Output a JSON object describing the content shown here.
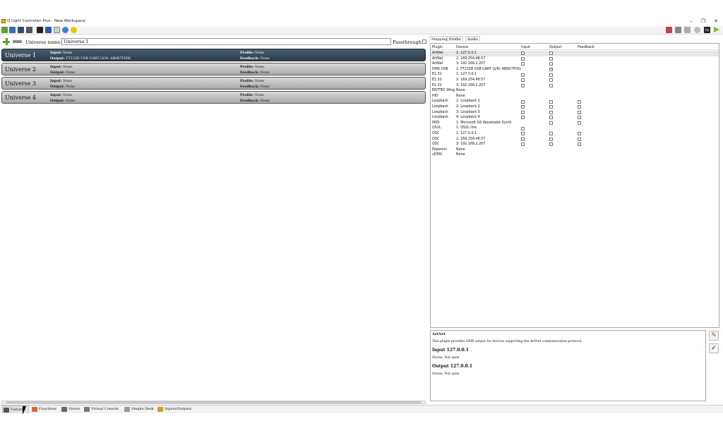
{
  "window": {
    "title": "Q Light Controller Plus - New Workspace",
    "minimize": "–",
    "restore": "❐",
    "close": "✕"
  },
  "universe_editor": {
    "name_label": "Universe name:",
    "name_value": "Universe 1",
    "passthrough_label": "Passthrough"
  },
  "universes": [
    {
      "name": "Universe 1",
      "input_label": "Input:",
      "input": "None",
      "output_label": "Output:",
      "output": "FT232R USB UART (S/N: AB0K7FHX)",
      "profile_label": "Profile:",
      "profile": "None",
      "feedback_label": "Feedback:",
      "feedback": "None"
    },
    {
      "name": "Universe 2",
      "input_label": "Input:",
      "input": "None",
      "output_label": "Output:",
      "output": "None",
      "profile_label": "Profile:",
      "profile": "None",
      "feedback_label": "Feedback:",
      "feedback": "None"
    },
    {
      "name": "Universe 3",
      "input_label": "Input:",
      "input": "None",
      "output_label": "Output:",
      "output": "None",
      "profile_label": "Profile:",
      "profile": "None",
      "feedback_label": "Feedback:",
      "feedback": "None"
    },
    {
      "name": "Universe 4",
      "input_label": "Input:",
      "input": "None",
      "output_label": "Output:",
      "output": "None",
      "profile_label": "Profile:",
      "profile": "None",
      "feedback_label": "Feedback:",
      "feedback": "None"
    }
  ],
  "right_tabs": [
    "Mapping",
    "Profile",
    "Audio"
  ],
  "mapping_table": {
    "columns": [
      "Plugin",
      "Device",
      "Input",
      "Output",
      "Feedback"
    ],
    "rows": [
      {
        "plugin": "ArtNet",
        "device": "1: 127.0.0.1",
        "input": true,
        "output": true,
        "feedback": false,
        "checked_output": false
      },
      {
        "plugin": "ArtNet",
        "device": "2: 169.254.48.57",
        "input": true,
        "output": true,
        "feedback": false,
        "checked_output": false
      },
      {
        "plugin": "ArtNet",
        "device": "3: 192.168.2.207",
        "input": true,
        "output": true,
        "feedback": false,
        "checked_output": false
      },
      {
        "plugin": "DMX USB",
        "device": "1: FT232R USB UART (S/N: AB0K7FHX)",
        "input": false,
        "output": true,
        "feedback": false,
        "checked_output": true
      },
      {
        "plugin": "E1.31",
        "device": "1: 127.0.0.1",
        "input": true,
        "output": true,
        "feedback": false,
        "checked_output": false
      },
      {
        "plugin": "E1.31",
        "device": "2: 169.254.48.57",
        "input": true,
        "output": true,
        "feedback": false,
        "checked_output": false
      },
      {
        "plugin": "E1.31",
        "device": "3: 192.168.2.207",
        "input": true,
        "output": true,
        "feedback": false,
        "checked_output": false
      },
      {
        "plugin": "ENTTEC Wing",
        "device": "None",
        "input": false,
        "output": false,
        "feedback": false,
        "checked_output": false
      },
      {
        "plugin": "HID",
        "device": "None",
        "input": false,
        "output": false,
        "feedback": false,
        "checked_output": false
      },
      {
        "plugin": "Loopback",
        "device": "1: Loopback 1",
        "input": true,
        "output": true,
        "feedback": true,
        "checked_output": false
      },
      {
        "plugin": "Loopback",
        "device": "2: Loopback 2",
        "input": true,
        "output": true,
        "feedback": true,
        "checked_output": false
      },
      {
        "plugin": "Loopback",
        "device": "3: Loopback 3",
        "input": true,
        "output": true,
        "feedback": true,
        "checked_output": false
      },
      {
        "plugin": "Loopback",
        "device": "4: Loopback 4",
        "input": true,
        "output": true,
        "feedback": true,
        "checked_output": false
      },
      {
        "plugin": "MIDI",
        "device": "1: Microsoft GS Wavetable Synth",
        "input": false,
        "output": true,
        "feedback": true,
        "checked_output": false
      },
      {
        "plugin": "OS2L",
        "device": "1: OS2L line",
        "input": true,
        "output": false,
        "feedback": false,
        "checked_output": false
      },
      {
        "plugin": "OSC",
        "device": "1: 127.0.0.1",
        "input": true,
        "output": true,
        "feedback": true,
        "checked_output": false
      },
      {
        "plugin": "OSC",
        "device": "2: 169.254.48.57",
        "input": true,
        "output": true,
        "feedback": true,
        "checked_output": false
      },
      {
        "plugin": "OSC",
        "device": "3: 192.168.2.207",
        "input": true,
        "output": true,
        "feedback": true,
        "checked_output": false
      },
      {
        "plugin": "Peperoni",
        "device": "None",
        "input": false,
        "output": false,
        "feedback": false,
        "checked_output": false
      },
      {
        "plugin": "uDMX",
        "device": "None",
        "input": false,
        "output": false,
        "feedback": false,
        "checked_output": false
      }
    ]
  },
  "info": {
    "title": "ArtNet",
    "description": "This plugin provides DMX output for devices supporting the ArtNet communication protocol.",
    "input_heading": "Input 127.0.0.1",
    "input_status": "Status: Not open",
    "output_heading": "Output 127.0.0.1",
    "output_status": "Status: Not open"
  },
  "bottom_tabs": [
    "Fixtures",
    "Functions",
    "Shows",
    "Virtual Console",
    "Simple Desk",
    "Inputs/Outputs"
  ],
  "toolbar_right_label": "Op",
  "colors": {
    "accent": "#2b3a47",
    "toolbar_bg": "#f4f4f4"
  }
}
